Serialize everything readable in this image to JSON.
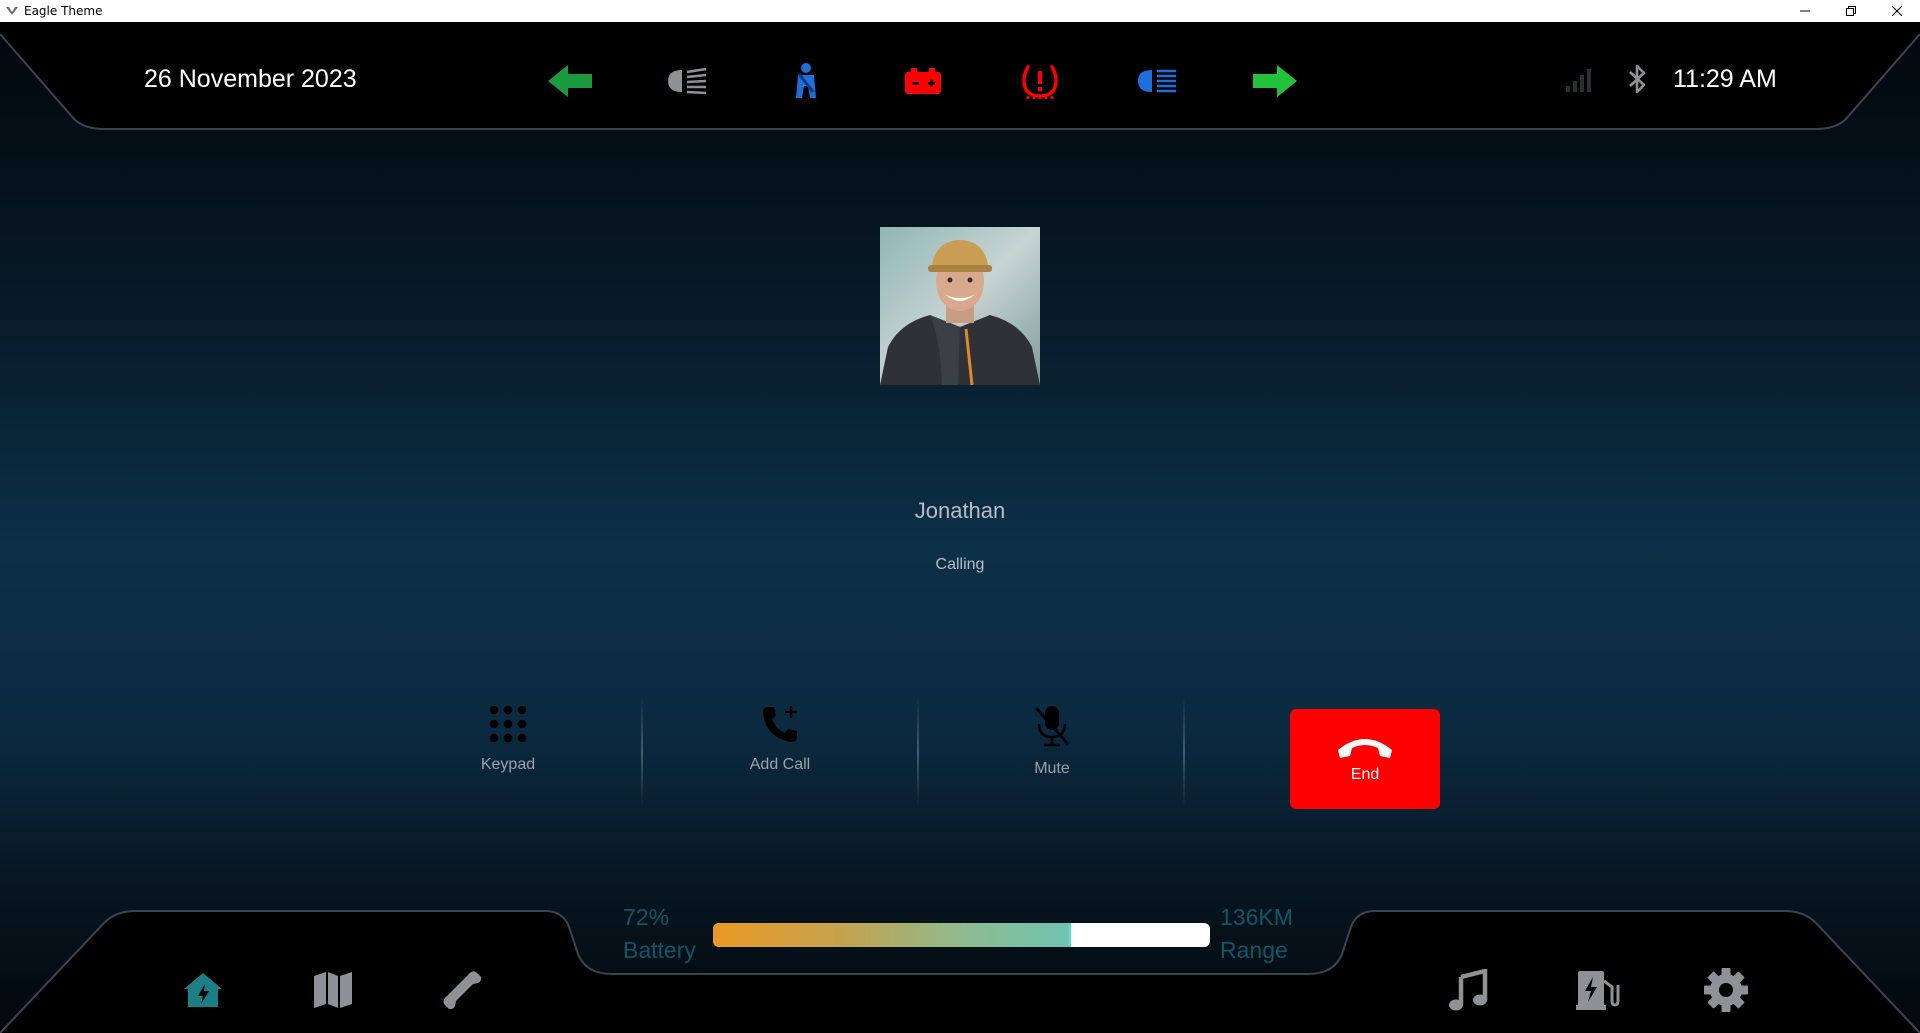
{
  "window": {
    "title": "Eagle Theme"
  },
  "status_bar": {
    "date": "26 November 2023",
    "time": "11:29 AM",
    "indicators": [
      {
        "name": "turn-left-arrow-icon",
        "color": "#1a9b3e"
      },
      {
        "name": "headlight-low-beam-icon",
        "color": "#8e9296"
      },
      {
        "name": "seatbelt-warning-icon",
        "color": "#1e6fd9"
      },
      {
        "name": "battery-warning-icon",
        "color": "#fe0000"
      },
      {
        "name": "tire-pressure-warning-icon",
        "color": "#fe0000"
      },
      {
        "name": "headlight-high-beam-icon",
        "color": "#1e6fd9"
      },
      {
        "name": "turn-right-arrow-icon",
        "color": "#22c23a"
      }
    ],
    "signal_icon": "signal-bars-icon",
    "bluetooth_icon": "bluetooth-icon"
  },
  "call": {
    "avatar_icon": "contact-photo",
    "caller_name": "Jonathan",
    "status": "Calling",
    "actions": {
      "keypad": "Keypad",
      "add_call": "Add Call",
      "mute": "Mute"
    },
    "end_label": "End",
    "end_color": "#fe0000"
  },
  "battery": {
    "percent_text": "72%",
    "label": "Battery",
    "level": 0.72,
    "range_value": "136KM",
    "range_label": "Range"
  },
  "nav": {
    "left": [
      "home-icon",
      "map-icon",
      "phone-icon"
    ],
    "right": [
      "music-icon",
      "ev-charger-icon",
      "settings-gear-icon"
    ],
    "active": "home-icon",
    "active_color": "#1b7f86"
  }
}
